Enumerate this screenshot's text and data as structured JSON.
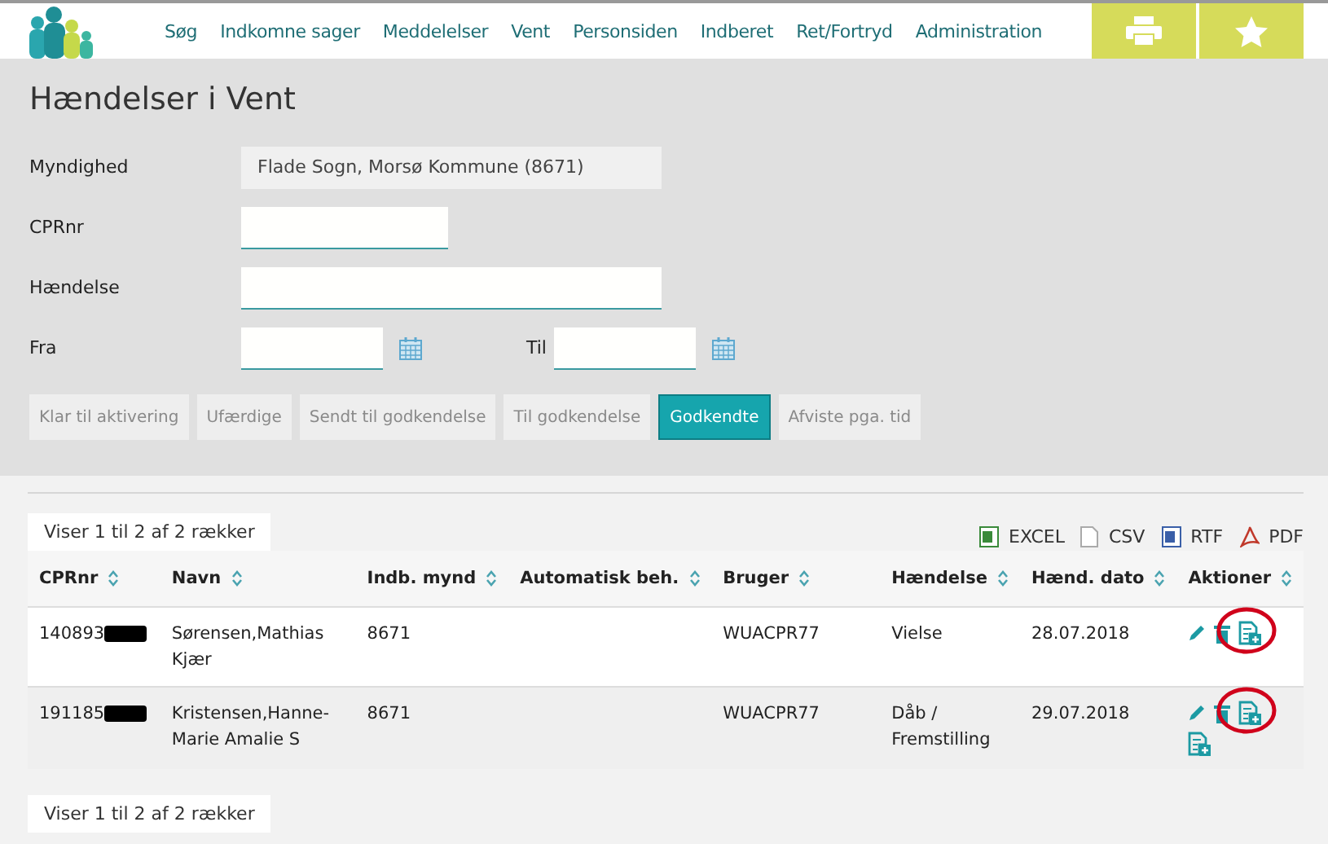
{
  "nav": {
    "items": [
      {
        "label": "Søg"
      },
      {
        "label": "Indkomne sager"
      },
      {
        "label": "Meddelelser"
      },
      {
        "label": "Vent"
      },
      {
        "label": "Personsiden"
      },
      {
        "label": "Indberet"
      },
      {
        "label": "Ret/Fortryd"
      },
      {
        "label": "Administration"
      }
    ],
    "buttons": [
      {
        "kind": "print"
      },
      {
        "kind": "star"
      }
    ]
  },
  "title": "Hændelser i Vent",
  "form": {
    "myndighed": {
      "label": "Myndighed",
      "value": "Flade Sogn, Morsø Kommune (8671)"
    },
    "cprnr": {
      "label": "CPRnr"
    },
    "haendelse": {
      "label": "Hændelse"
    },
    "fra": {
      "label": "Fra"
    },
    "til": {
      "label": "Til"
    }
  },
  "status_tabs": [
    {
      "label": "Klar til aktivering",
      "selected": false
    },
    {
      "label": "Ufærdige",
      "selected": false
    },
    {
      "label": "Sendt til godkendelse",
      "selected": false
    },
    {
      "label": "Til godkendelse",
      "selected": false
    },
    {
      "label": "Godkendte",
      "selected": true
    },
    {
      "label": "Afviste pga. tid",
      "selected": false
    }
  ],
  "table": {
    "info_top": "Viser 1 til 2 af 2 rækker",
    "info_bottom": "Viser 1 til 2 af 2 rækker",
    "exports": [
      {
        "kind": "excel",
        "label": "EXCEL"
      },
      {
        "kind": "csv",
        "label": "CSV"
      },
      {
        "kind": "rtf",
        "label": "RTF"
      },
      {
        "kind": "pdf",
        "label": "PDF"
      }
    ],
    "columns": [
      "CPRnr",
      "Navn",
      "Indb. mynd",
      "Automatisk beh.",
      "Bruger",
      "Hændelse",
      "Hænd. dato",
      "Aktioner"
    ],
    "rows": [
      {
        "cprnr": "140893",
        "name": "Sørensen,Mathias Kjær",
        "mynd": "8671",
        "auto": "",
        "user": "WUACPR77",
        "event": "Vielse",
        "date": "28.07.2018",
        "actions": [
          {
            "kind": "edit",
            "circled": false
          },
          {
            "kind": "delete",
            "circled": false
          },
          {
            "kind": "add-document",
            "circled": true
          }
        ]
      },
      {
        "cprnr": "191185",
        "name": "Kristensen,Hanne-Marie Amalie S",
        "mynd": "8671",
        "auto": "",
        "user": "WUACPR77",
        "event": "Dåb / Fremstilling",
        "date": "29.07.2018",
        "actions": [
          {
            "kind": "edit",
            "circled": false
          },
          {
            "kind": "delete",
            "circled": false
          },
          {
            "kind": "add-document",
            "circled": true
          },
          {
            "kind": "add-document",
            "circled": false
          }
        ]
      }
    ]
  }
}
